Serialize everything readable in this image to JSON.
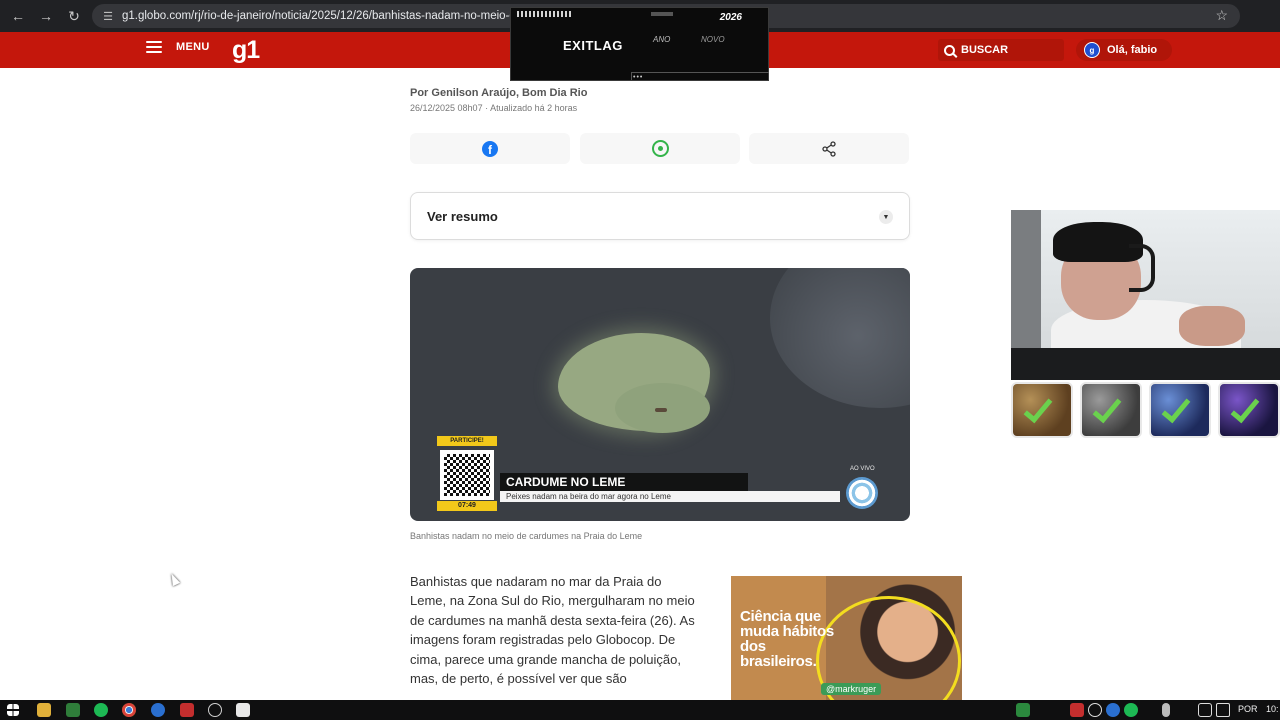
{
  "browser": {
    "url": "g1.globo.com/rj/rio-de-janeiro/noticia/2025/12/26/banhistas-nadam-no-meio-de"
  },
  "header": {
    "menu_label": "MENU",
    "logo_text": "g1",
    "search_label": "BUSCAR",
    "user_greeting": "Olá, fabio",
    "brand_color": "#c4170c"
  },
  "overlay": {
    "exitlag_logo": "EXITLAG",
    "exitlag_year": "2026",
    "exitlag_ano": "ANO",
    "exitlag_novo": "NOVO",
    "exitlag_dots": "•••"
  },
  "article": {
    "byline": "Por Genilson Araújo, Bom Dia Rio",
    "dateline": "26/12/2025 08h07 · Atualizado há 2 horas",
    "summary_label": "Ver resumo",
    "video": {
      "badge": "PARTICIPE!",
      "time": "07:49",
      "headline": "CARDUME NO LEME",
      "subline": "Peixes nadam na beira do mar agora no Leme",
      "live_label": "AO VIVO"
    },
    "caption": "Banhistas nadam no meio de cardumes na Praia do Leme",
    "body": "Banhistas que nadaram no mar da Praia do Leme, na Zona Sul do Rio, mergulharam no meio de cardumes na manhã desta sexta-feira (26). As imagens foram registradas pelo Globocop. De cima, parece uma grande mancha de poluição, mas, de perto, é possível ver que são"
  },
  "ad": {
    "text": "Ciência que muda hábitos dos brasileiros.",
    "handle": "@markruger",
    "accent_color": "#f3dd1f"
  },
  "taskbar": {
    "language": "POR",
    "clock": "10:"
  }
}
